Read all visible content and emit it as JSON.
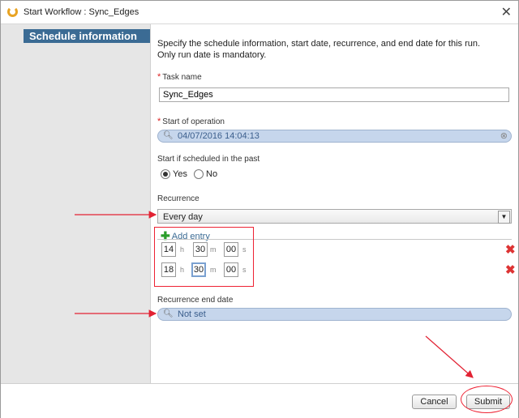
{
  "window": {
    "title": "Start Workflow : Sync_Edges",
    "close_icon": "close-icon"
  },
  "sidebar": {
    "items": [
      {
        "label": "Schedule information"
      }
    ]
  },
  "form": {
    "intro_line1": "Specify the schedule information, start date, recurrence, and end date for this run.",
    "intro_line2": "Only run date is mandatory.",
    "required_mark": "*",
    "task_name_label": "Task name",
    "task_name_value": "Sync_Edges",
    "start_label": "Start of operation",
    "start_value": "04/07/2016 14:04:13",
    "past_label": "Start if scheduled in the past",
    "yes_label": "Yes",
    "no_label": "No",
    "past_selected": "Yes",
    "recurrence_label": "Recurrence",
    "recurrence_value": "Every day",
    "add_entry_label": "Add entry",
    "entries": [
      {
        "h": "14",
        "m": "30",
        "s": "00"
      },
      {
        "h": "18",
        "m": "30",
        "s": "00"
      }
    ],
    "unit_h": "h",
    "unit_m": "m",
    "unit_s": "s",
    "end_label": "Recurrence end date",
    "end_value": "Not set"
  },
  "footer": {
    "cancel_label": "Cancel",
    "submit_label": "Submit"
  },
  "colors": {
    "accent": "#3b6b94",
    "annotation": "#e22233",
    "date_field": "#c6d6ec"
  }
}
